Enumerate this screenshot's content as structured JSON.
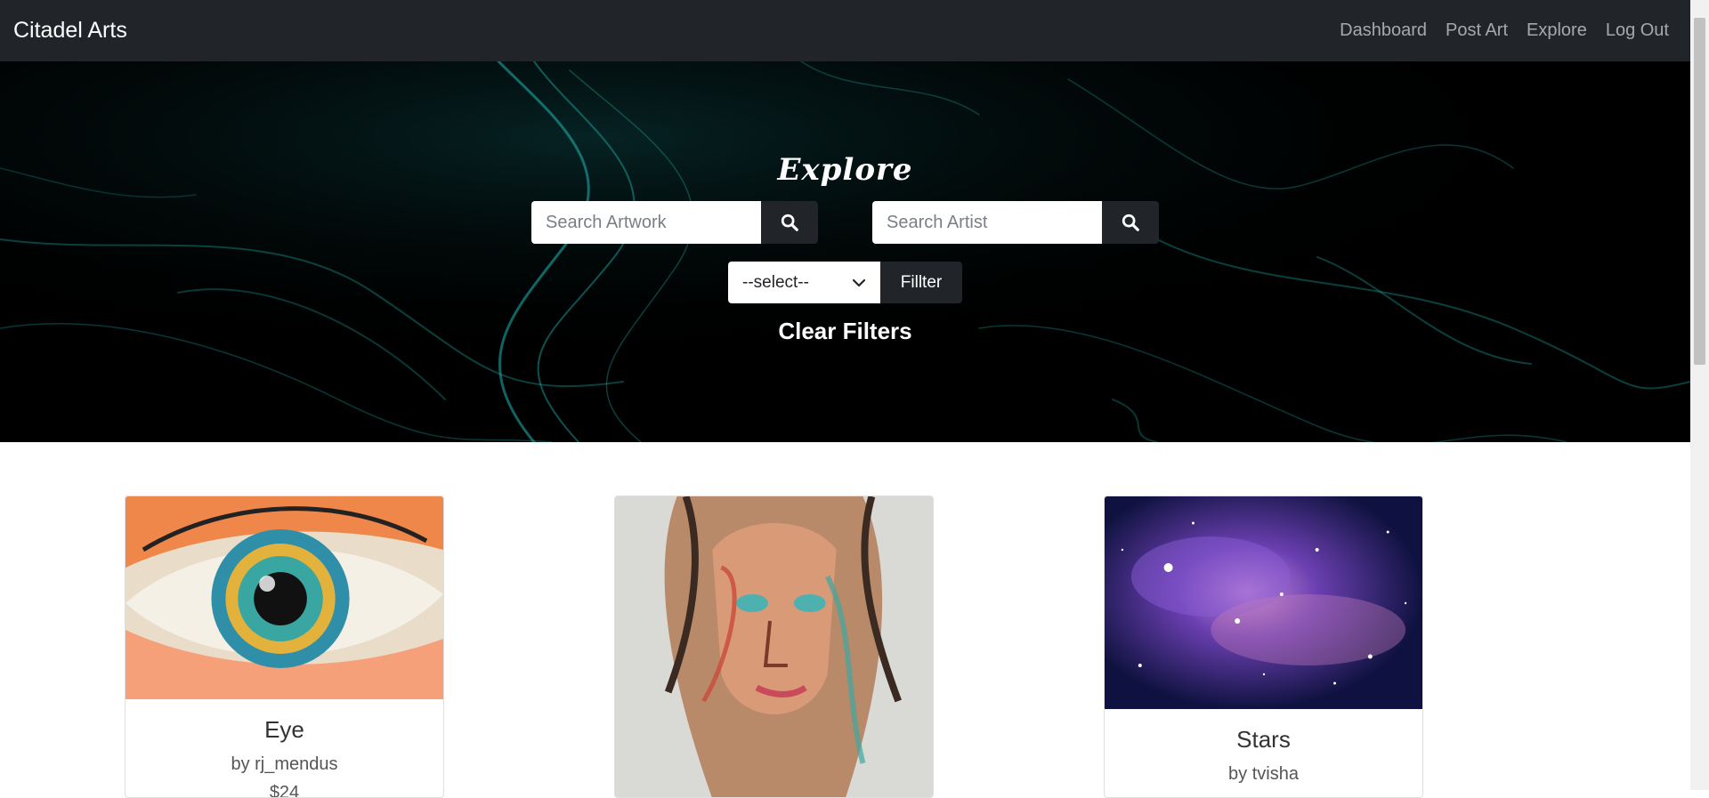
{
  "navbar": {
    "brand": "Citadel Arts",
    "links": [
      "Dashboard",
      "Post Art",
      "Explore",
      "Log Out"
    ]
  },
  "hero": {
    "title": "Explore",
    "search_artwork_placeholder": "Search Artwork",
    "search_artist_placeholder": "Search Artist",
    "select_value": "--select--",
    "filter_label": "Fillter",
    "clear_filters_label": "Clear Filters"
  },
  "cards": [
    {
      "title": "Eye",
      "artist": "by rj_mendus",
      "price": "$24"
    },
    {
      "title": "",
      "artist": "",
      "price": ""
    },
    {
      "title": "Stars",
      "artist": "by tvisha",
      "price": ""
    }
  ],
  "colors": {
    "navbar_bg": "#212529",
    "hero_bg": "#000000",
    "accent_teal": "#1fb5b0",
    "button_dark": "#212529"
  },
  "icons": {
    "search": "search-icon",
    "dropdown": "chevron-down-icon"
  }
}
